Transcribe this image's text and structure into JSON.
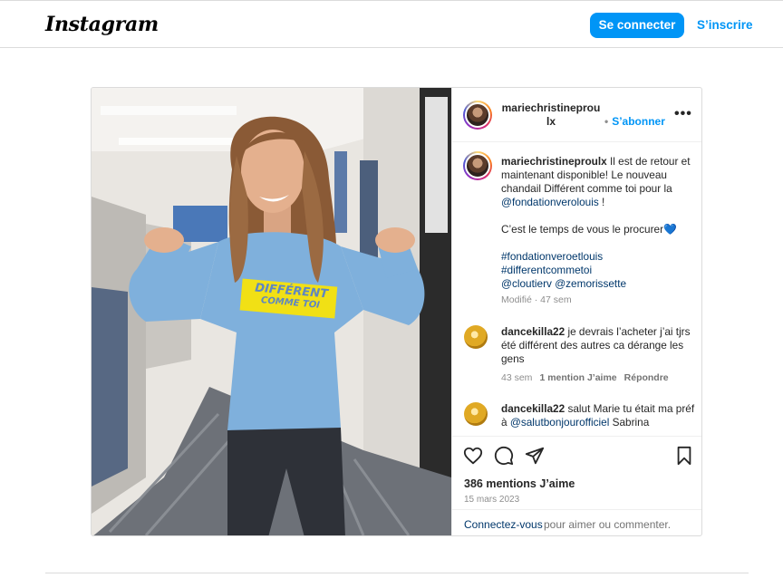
{
  "header": {
    "logo": "Instagram",
    "login_label": "Se connecter",
    "signup_label": "S’inscrire"
  },
  "post": {
    "username": "mariechristineproulx",
    "username_line1": "mariechristineprou",
    "username_line2": "lx",
    "follow_label": "S’abonner",
    "caption_username": "mariechristineproulx",
    "caption_text": "Il est de retour et maintenant disponible! Le nouveau chandail Différent comme toi pour la",
    "caption_mention": "@fondationverolouis",
    "caption_end": "!",
    "caption_line2": "C’est le temps de vous le procurer💙",
    "hashtags": [
      "#fondationveroetlouis",
      "#differentcommetoi"
    ],
    "mentions": [
      "@cloutierv",
      "@zemorissette"
    ],
    "caption_meta": "Modifié · 47 sem",
    "shirt_text1": "DIFFÉRENT",
    "shirt_text2": "COMME TOI",
    "likes": "386 mentions J’aime",
    "date": "15 mars 2023"
  },
  "comments": [
    {
      "username": "dancekilla22",
      "text": "je devrais l’acheter j’ai tjrs été différent des autres ca dérange les gens",
      "time": "43 sem",
      "likes": "1 mention J’aime",
      "reply": "Répondre"
    },
    {
      "username": "dancekilla22",
      "text": "salut Marie tu était ma préf à",
      "mention": "@salutbonjourofficiel",
      "text_end": "Sabrina"
    }
  ],
  "login_prompt": {
    "link": "Connectez-vous",
    "text": " pour aimer ou commenter."
  },
  "colors": {
    "accent": "#0095f6",
    "link": "#00376b",
    "sweater": "#7fb0dc",
    "shirt_print": "#f1e015"
  }
}
